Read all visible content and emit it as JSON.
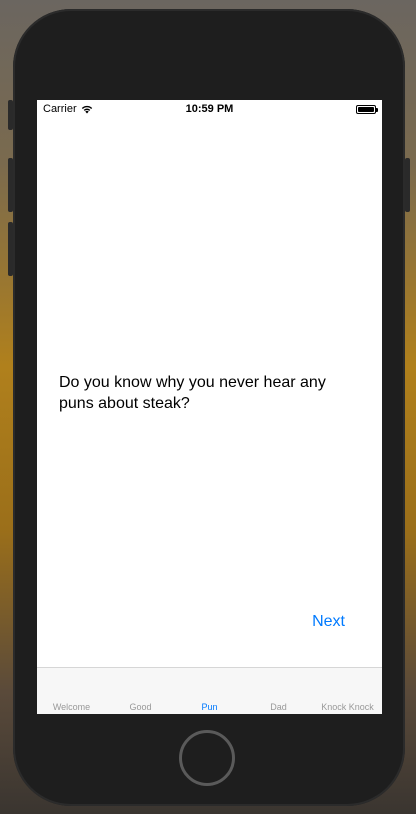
{
  "status_bar": {
    "carrier": "Carrier",
    "time": "10:59 PM"
  },
  "joke": {
    "text": "Do you know why you never hear any puns about steak?"
  },
  "actions": {
    "next_label": "Next"
  },
  "tabs": [
    {
      "label": "Welcome",
      "active": false
    },
    {
      "label": "Good",
      "active": false
    },
    {
      "label": "Pun",
      "active": true
    },
    {
      "label": "Dad",
      "active": false
    },
    {
      "label": "Knock Knock",
      "active": false
    }
  ],
  "colors": {
    "accent": "#007aff",
    "inactive_tab": "#999999"
  }
}
